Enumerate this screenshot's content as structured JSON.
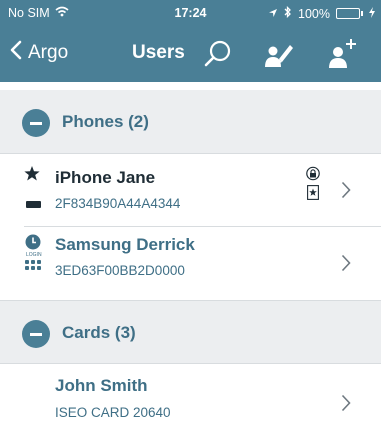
{
  "status_bar": {
    "carrier": "No SIM",
    "time": "17:24",
    "battery": "100%",
    "wifi_icon": "wifi-icon",
    "location_icon": "location-arrow-icon",
    "bluetooth_icon": "bluetooth-icon",
    "charging_icon": "charging-bolt-icon"
  },
  "nav": {
    "back_label": "Argo",
    "title": "Users",
    "search_icon": "search-icon",
    "edit_icon": "edit-user-icon",
    "add_icon": "add-user-icon"
  },
  "sections": [
    {
      "title": "Phones (2)",
      "items": [
        {
          "name": "iPhone Jane",
          "sub": "2F834B90A44A4344",
          "left_icons": [
            "star-icon",
            "login-chip-icon"
          ],
          "right_icons": [
            "lock-icon",
            "star-badge-icon"
          ]
        },
        {
          "name": "Samsung Derrick",
          "sub": "3ED63F00BB2D0000",
          "left_icons": [
            "clock-icon",
            "login-text-icon",
            "keypad-icon"
          ],
          "right_icons": []
        }
      ]
    },
    {
      "title": "Cards (3)",
      "items": [
        {
          "name": "John Smith",
          "sub": "ISEO CARD 20640",
          "left_icons": [],
          "right_icons": []
        }
      ]
    }
  ],
  "colors": {
    "header_bg": "#4a7f96",
    "accent": "#3f6f86",
    "section_bg": "#eceef0",
    "battery_green": "#4cd964"
  }
}
